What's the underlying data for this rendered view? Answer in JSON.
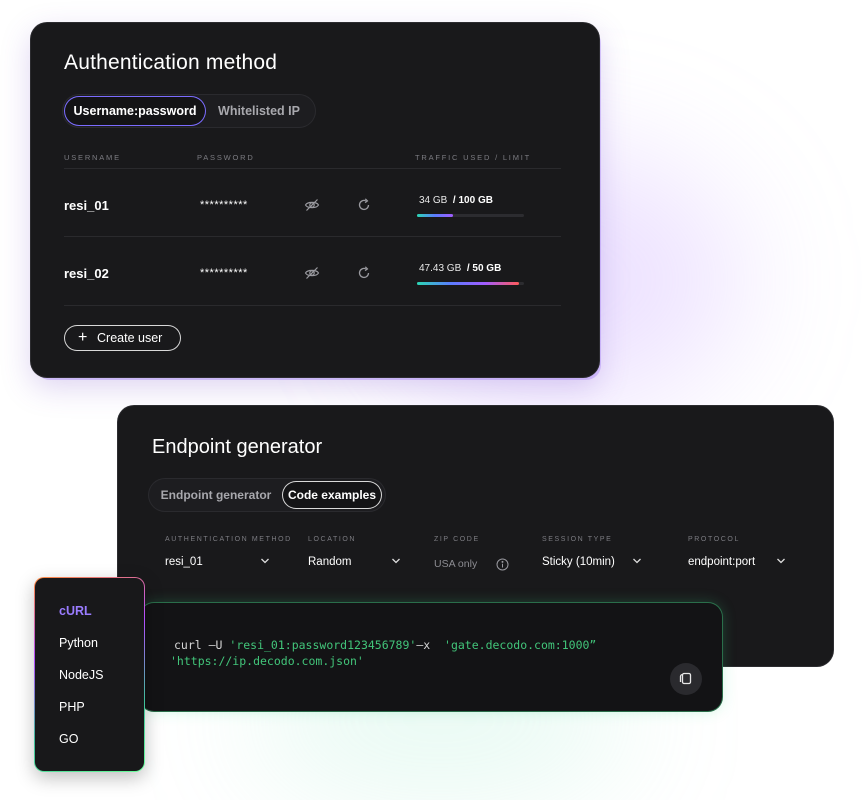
{
  "auth": {
    "title": "Authentication method",
    "tabs": [
      {
        "label": "Username:password",
        "active": true
      },
      {
        "label": "Whitelisted IP",
        "active": false
      }
    ],
    "columns": {
      "username": "USERNAME",
      "password": "PASSWORD",
      "traffic": "TRAFFIC USED / LIMIT"
    },
    "users": [
      {
        "username": "resi_01",
        "password": "**********",
        "used": "34 GB",
        "limit": "/ 100 GB",
        "usage_fraction": 0.34
      },
      {
        "username": "resi_02",
        "password": "**********",
        "used": "47.43 GB",
        "limit": "/ 50 GB",
        "usage_fraction": 0.9486
      }
    ],
    "create_button": "Create user",
    "icons": {
      "toggle_visibility": "eye-off-icon",
      "regenerate": "refresh-icon",
      "add": "plus-icon"
    }
  },
  "endpoint": {
    "title": "Endpoint generator",
    "tabs": [
      {
        "label": "Endpoint generator",
        "active": false
      },
      {
        "label": "Code examples",
        "active": true
      }
    ],
    "fields": [
      {
        "label": "AUTHENTICATION METHOD",
        "value": "resi_01",
        "dropdown": true
      },
      {
        "label": "LOCATION",
        "value": "Random",
        "dropdown": true
      },
      {
        "label": "ZIP CODE",
        "value": "USA only",
        "info": true
      },
      {
        "label": "SESSION TYPE",
        "value": "Sticky (10min)",
        "dropdown": true
      },
      {
        "label": "PROTOCOL",
        "value": "endpoint:port",
        "dropdown": true
      }
    ]
  },
  "code": {
    "line1_cmd": "curl –U ",
    "line1_cred": "'resi_01:password123456789'",
    "line1_flag": "–x  ",
    "line1_host": "'gate.decodo.com:1000”",
    "line2_url": "'https://ip.decodo.com.json'",
    "copy_icon": "copy-icon"
  },
  "languages": [
    {
      "label": "cURL",
      "active": true
    },
    {
      "label": "Python",
      "active": false
    },
    {
      "label": "NodeJS",
      "active": false
    },
    {
      "label": "PHP",
      "active": false
    },
    {
      "label": "GO",
      "active": false
    }
  ],
  "colors": {
    "card_bg": "#19191b",
    "accent_purple": "#9a7cff",
    "code_green": "#42c57a",
    "page_bg": "#ffffff"
  }
}
